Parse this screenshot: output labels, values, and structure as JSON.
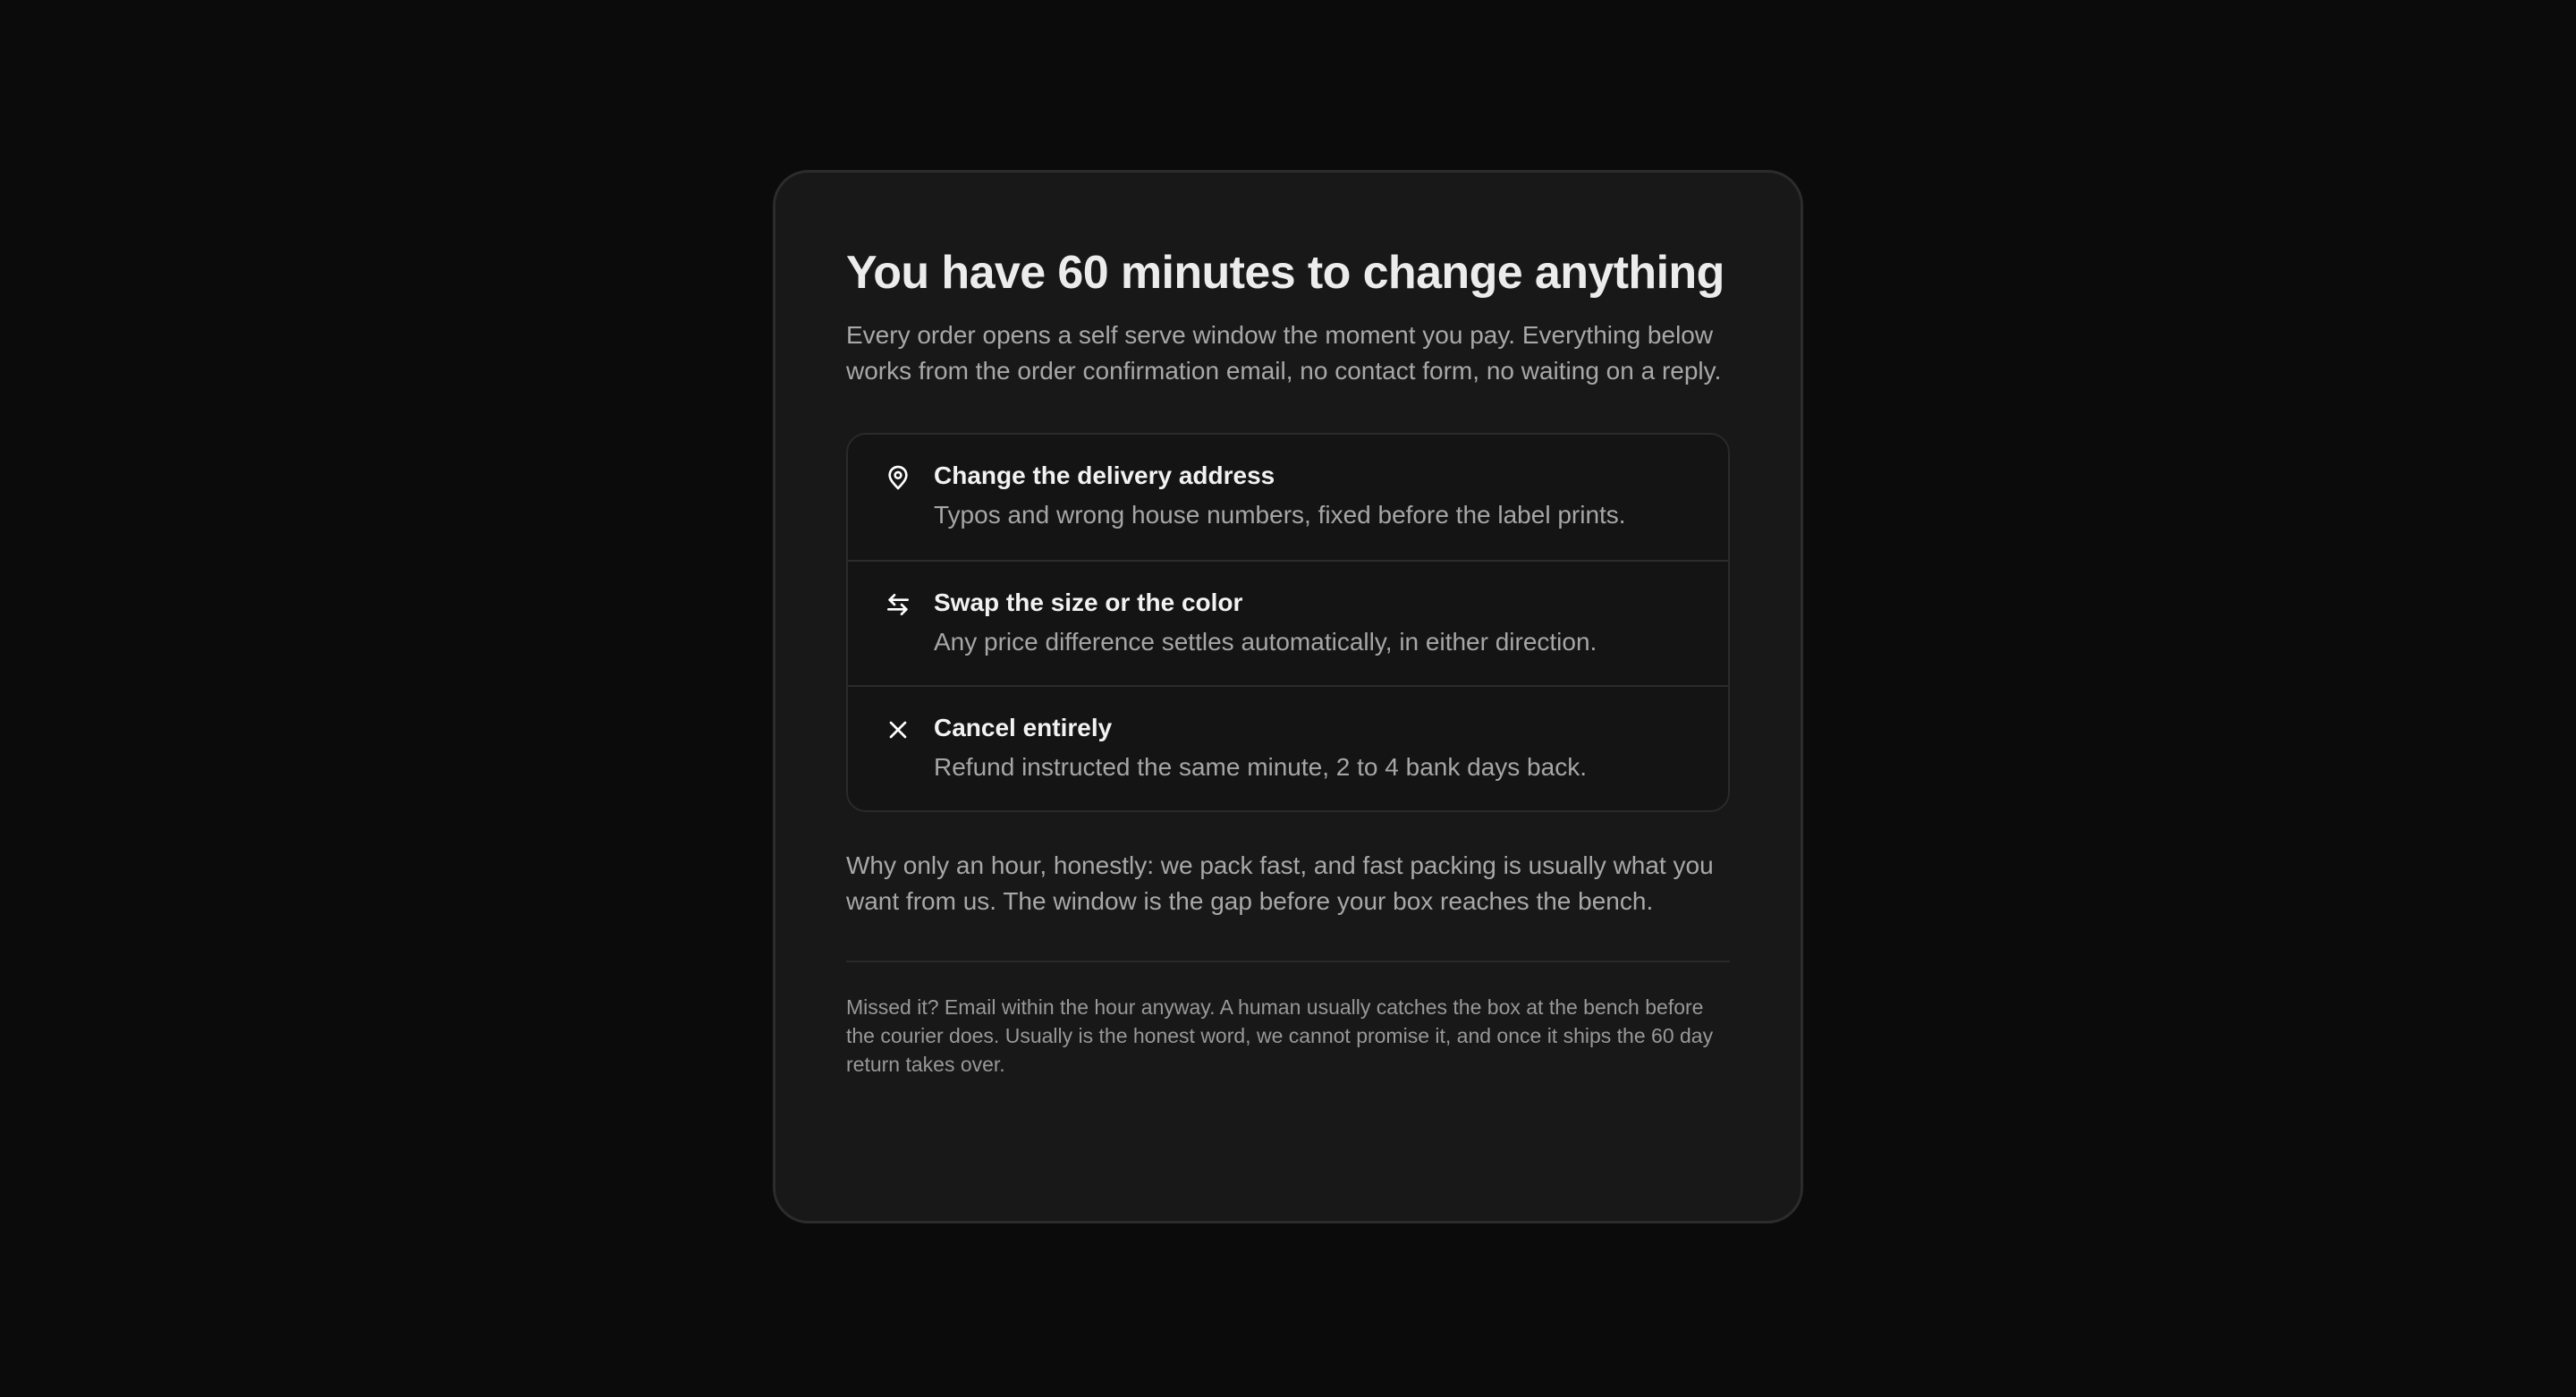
{
  "card": {
    "title": "You have 60 minutes to change anything",
    "intro": "Every order opens a self serve window the moment you pay. Everything below works from the order confirmation email, no contact form, no waiting on a reply.",
    "options": [
      {
        "icon": "map-pin-icon",
        "title": "Change the delivery address",
        "description": "Typos and wrong house numbers, fixed before the label prints."
      },
      {
        "icon": "swap-arrows-icon",
        "title": "Swap the size or the color",
        "description": "Any price difference settles automatically, in either direction."
      },
      {
        "icon": "close-icon",
        "title": "Cancel entirely",
        "description": "Refund instructed the same minute, 2 to 4 bank days back."
      }
    ],
    "why": "Why only an hour, honestly: we pack fast, and fast packing is usually what you want from us. The window is the gap before your box reaches the bench.",
    "note": "Missed it? Email within the hour anyway. A human usually catches the box at the bench before the courier does. Usually is the honest word, we cannot promise it, and once it ships the 60 day return takes over."
  },
  "colors": {
    "background": "#0b0b0b",
    "card": "#181818",
    "title": "#ececec",
    "body_text": "#a8a8a8",
    "option_title": "#f2f2f2"
  }
}
